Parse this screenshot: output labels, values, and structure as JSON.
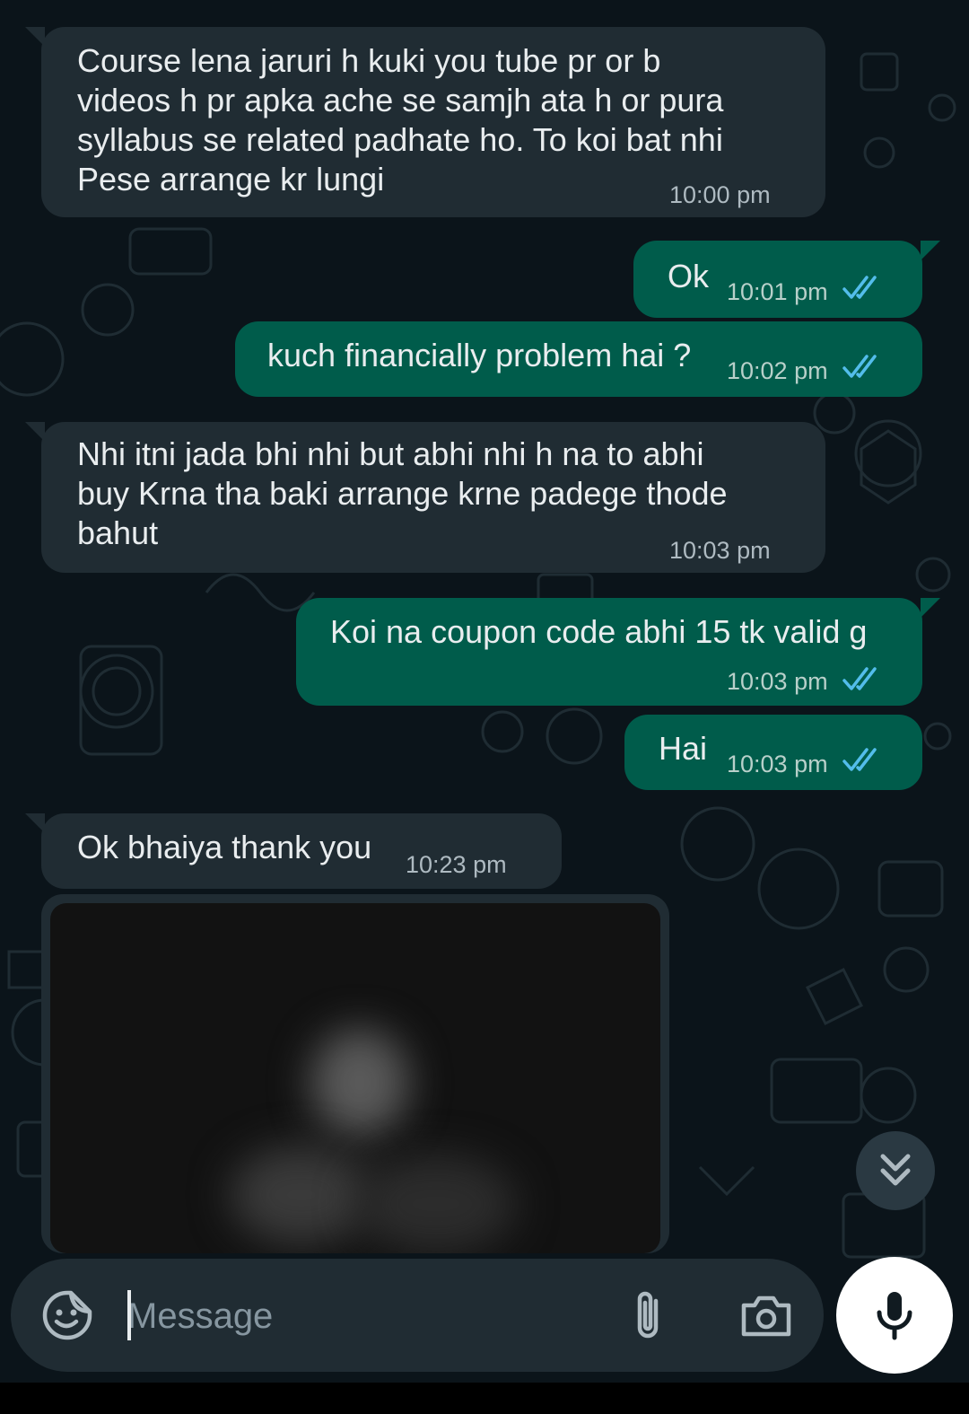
{
  "colors": {
    "background": "#0b141a",
    "incoming_bubble": "#202c33",
    "outgoing_bubble": "#005c4b",
    "read_ticks": "#53bdeb",
    "composer": "#202c33",
    "mic_button": "#ffffff"
  },
  "messages": [
    {
      "direction": "incoming",
      "text": "Course lena jaruri h kuki  you tube pr or b\nvideos h pr apka ache se samjh ata h or pura\nsyllabus se related padhate ho. To koi bat nhi\nPese arrange kr lungi",
      "time": "10:00 pm"
    },
    {
      "direction": "outgoing",
      "text": "Ok",
      "time": "10:01 pm",
      "status": "read"
    },
    {
      "direction": "outgoing",
      "text": "kuch financially problem  hai ?",
      "time": "10:02 pm",
      "status": "read"
    },
    {
      "direction": "incoming",
      "text": "Nhi itni jada bhi nhi  but abhi nhi h na to abhi\nbuy Krna tha baki arrange krne padege thode\nbahut",
      "time": "10:03 pm"
    },
    {
      "direction": "outgoing",
      "text": "Koi na coupon code abhi 15 tk valid g",
      "time": "10:03 pm",
      "status": "read"
    },
    {
      "direction": "outgoing",
      "text": "Hai",
      "time": "10:03 pm",
      "status": "read"
    },
    {
      "direction": "incoming",
      "text": "Ok bhaiya thank you",
      "time": "10:23 pm"
    }
  ],
  "media_message": {
    "direction": "incoming",
    "type": "image",
    "state": "blurred"
  },
  "composer": {
    "placeholder": "Message",
    "emoji_icon": "sticker-emoji-icon",
    "attach_icon": "paperclip-icon",
    "camera_icon": "camera-icon",
    "mic_icon": "microphone-icon"
  },
  "scroll_button_icon": "double-chevron-down-icon"
}
